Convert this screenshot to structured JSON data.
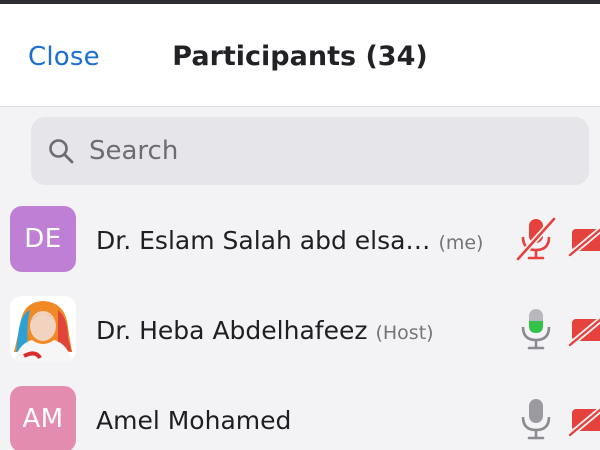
{
  "header": {
    "close_label": "Close",
    "title": "Participants (34)"
  },
  "search": {
    "placeholder": "Search"
  },
  "participants": [
    {
      "initials": "DE",
      "avatar_color": "#be7fd4",
      "name": "Dr. Eslam Salah abd elsa…",
      "tag": "(me)",
      "mic": "muted",
      "video": "off"
    },
    {
      "initials": "",
      "avatar": "photo",
      "name": "Dr. Heba Abdelhafeez",
      "tag": "(Host)",
      "mic": "active-speaking",
      "video": "off"
    },
    {
      "initials": "AM",
      "avatar_color": "#e48bb0",
      "name": "Amel Mohamed",
      "tag": "",
      "mic": "unmuted",
      "video": "off"
    }
  ],
  "colors": {
    "link": "#1b6fd1",
    "muted_red": "#e5413d",
    "speaking_green": "#35c24a",
    "icon_gray": "#8a8a90"
  }
}
